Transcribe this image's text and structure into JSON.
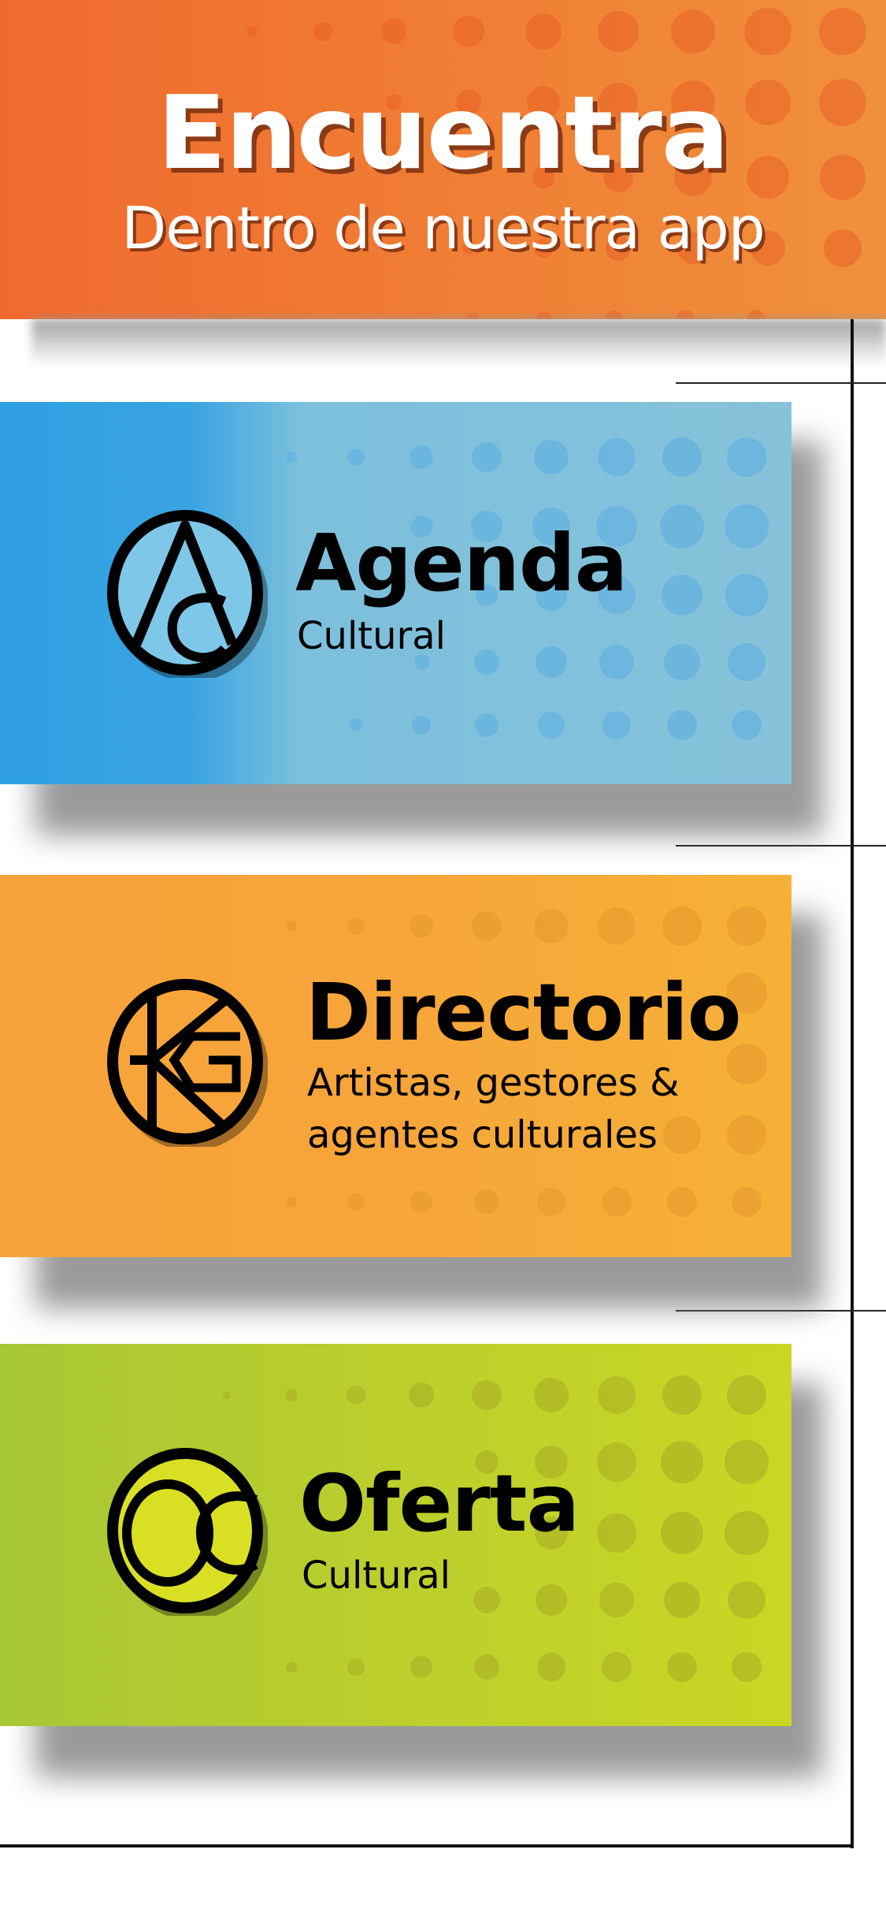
{
  "header": {
    "title": "Encuentra",
    "subtitle": "Dentro de nuestra app"
  },
  "sections": [
    {
      "title": "Agenda",
      "subtitle": "Cultural",
      "icon": "agenda-logo-icon",
      "color": "#39a4e2"
    },
    {
      "title": "Directorio",
      "subtitle_line1": "Artistas, gestores &",
      "subtitle_line2": "agentes culturales",
      "icon": "directorio-logo-icon",
      "color": "#f7a13a"
    },
    {
      "title": "Oferta",
      "subtitle": "Cultural",
      "icon": "oferta-logo-icon",
      "color": "#bccf2c"
    }
  ],
  "colors": {
    "header": "#ef6a2e",
    "frame": "#111111"
  }
}
